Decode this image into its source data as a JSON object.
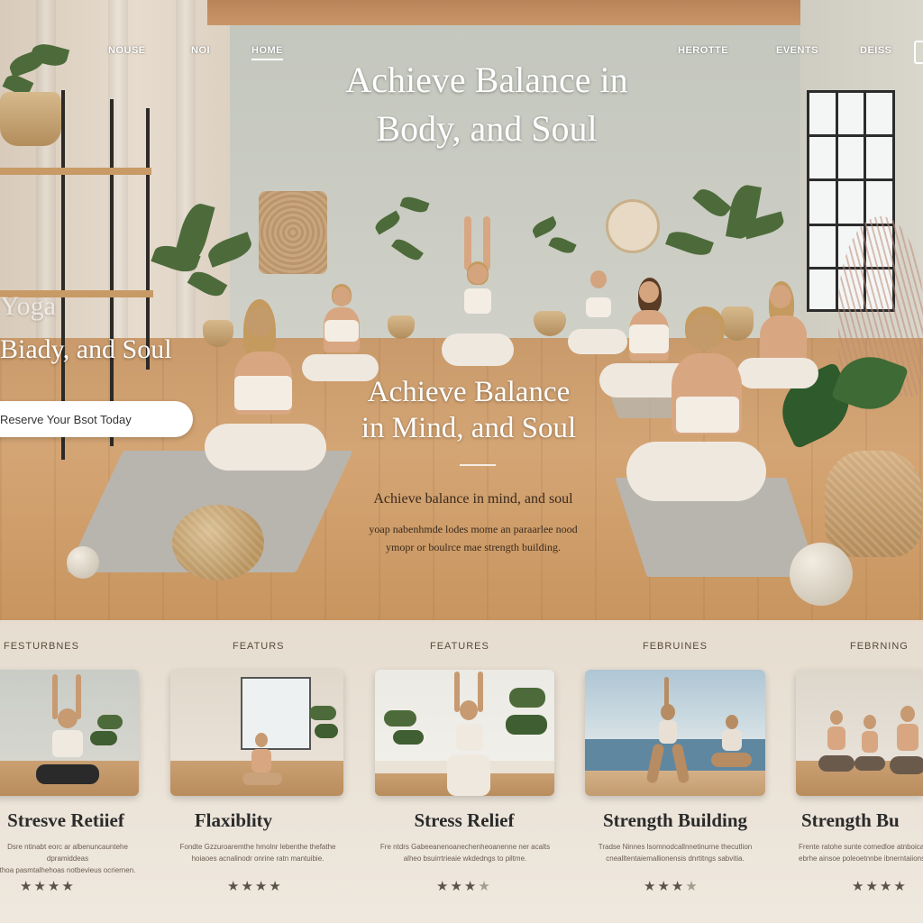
{
  "nav": {
    "items": [
      {
        "label": "NOUSE"
      },
      {
        "label": "NOI"
      },
      {
        "label": "HOME",
        "active": true
      },
      {
        "label": "HEROTTE"
      },
      {
        "label": "EVENTS"
      },
      {
        "label": "DEISS"
      }
    ]
  },
  "hero": {
    "title_line1": "Achieve Balance in",
    "title_line2": "Body, and Soul",
    "side_title_line1": "Yoga",
    "side_title_line2": "Biady, and Soul",
    "cta_label": "Reserve Your Bsot Today",
    "mid_title_line1": "Achieve Balance",
    "mid_title_line2": "in Mind, and Soul",
    "desc_title": "Achieve balance in mind, and soul",
    "desc_line1": "yoap nabenhmde lodes mome an paraarlee nood",
    "desc_line2": "ymopr or boulrce mae strength building."
  },
  "features": {
    "cards": [
      {
        "label": "FESTURBNES",
        "title": "Stresve Retiief",
        "text_line1": "Dsre ntinabt eorc ar albenuncauntehe dpramiddeas",
        "text_line2": "thoa pasmtalhehoas notbevieus ocriernen.",
        "rating": 4,
        "stars": "★★★★",
        "stars_dim": ""
      },
      {
        "label": "FEATURS",
        "title": "Flaxiblity",
        "text_line1": "Fondte Gzzuroaremthe hmolnr lebenthe thefathe",
        "text_line2": "hoiaoes acnalinodr onrine ratn mantuibie.",
        "rating": 4,
        "stars": "★★★★",
        "stars_dim": ""
      },
      {
        "label": "FEATURES",
        "title": "Stress Relief",
        "text_line1": "Fre ntdrs Gabeeanenoanechenheoanenne ner acalts",
        "text_line2": "alheo bsuirrtrieaie wkdedngs to piltme.",
        "rating": 3,
        "stars": "★★★",
        "stars_dim": "★"
      },
      {
        "label": "FEBRUINES",
        "title": "Strength Building",
        "text_line1": "Tradse Ninnes lsomnodcallnnetinurne thecutlion",
        "text_line2": "cnealltentaiemallionensis dnrtitngs sabvitia.",
        "rating": 3,
        "stars": "★★★",
        "stars_dim": "★"
      },
      {
        "label": "FEBRNING",
        "title": "Strength Bu",
        "text_line1": "Frente ratohe sunte comedloe atnboicate",
        "text_line2": "ebrhe ainsoe poleoetnnbe ibnerntaiions.",
        "rating": 4,
        "stars": "★★★★",
        "stars_dim": ""
      }
    ]
  },
  "colors": {
    "floor": "#d4a574",
    "wall": "#cfd0c7",
    "features_bg": "#e9e1d6",
    "title_text": "#2b2b2b",
    "accent_white": "#ffffff"
  },
  "icons": [
    "star-icon",
    "menu-edge-icon"
  ]
}
